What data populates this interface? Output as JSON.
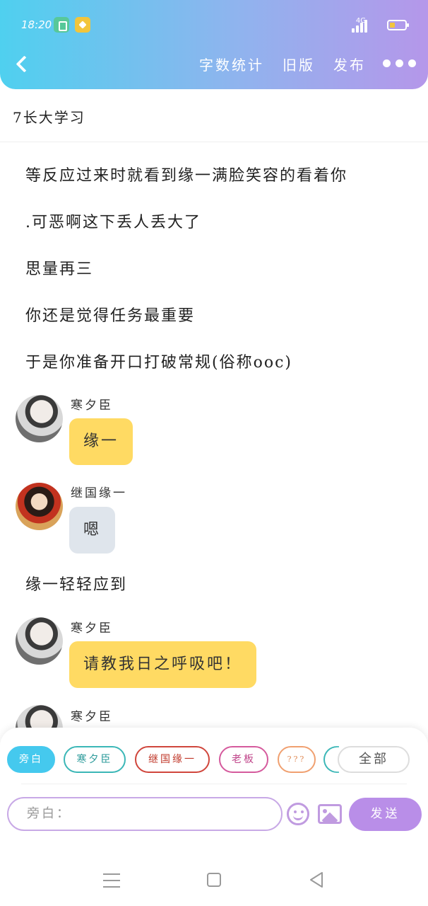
{
  "status_bar": {
    "time": "18:20",
    "network": "4G"
  },
  "header": {
    "actions": {
      "word_count": "字数统计",
      "old_version": "旧版",
      "publish": "发布"
    }
  },
  "document": {
    "title": "7长大学习"
  },
  "narration": [
    "等反应过来时就看到缘一满脸笑容的看着你",
    ".可恶啊这下丢人丢大了",
    "思量再三",
    "你还是觉得任务最重要",
    "于是你准备开口打破常规(俗称ooc)"
  ],
  "messages": [
    {
      "speaker": "寒夕臣",
      "text": "缘一"
    },
    {
      "speaker": "继国缘一",
      "text": "嗯"
    },
    {
      "narration": "缘一轻轻应到"
    },
    {
      "speaker": "寒夕臣",
      "text": "请教我日之呼吸吧！"
    },
    {
      "speaker": "寒夕臣"
    }
  ],
  "roles": {
    "chips": [
      "旁白",
      "寒夕臣",
      "继国缘一",
      "老板",
      "???"
    ],
    "all": "全部",
    "colors": {
      "active": "#45c9ee",
      "han": "#3bb7b7",
      "yuan": "#d0463c",
      "boss": "#d55a9d",
      "unknown": "#f0a070"
    }
  },
  "composer": {
    "placeholder": "旁白：",
    "send": "发送"
  },
  "colors": {
    "header_start": "#4fd0ef",
    "header_end": "#b597ea",
    "bubble_yellow": "#ffda63",
    "bubble_gray": "#dfe5ec",
    "send": "#b98ee8"
  }
}
